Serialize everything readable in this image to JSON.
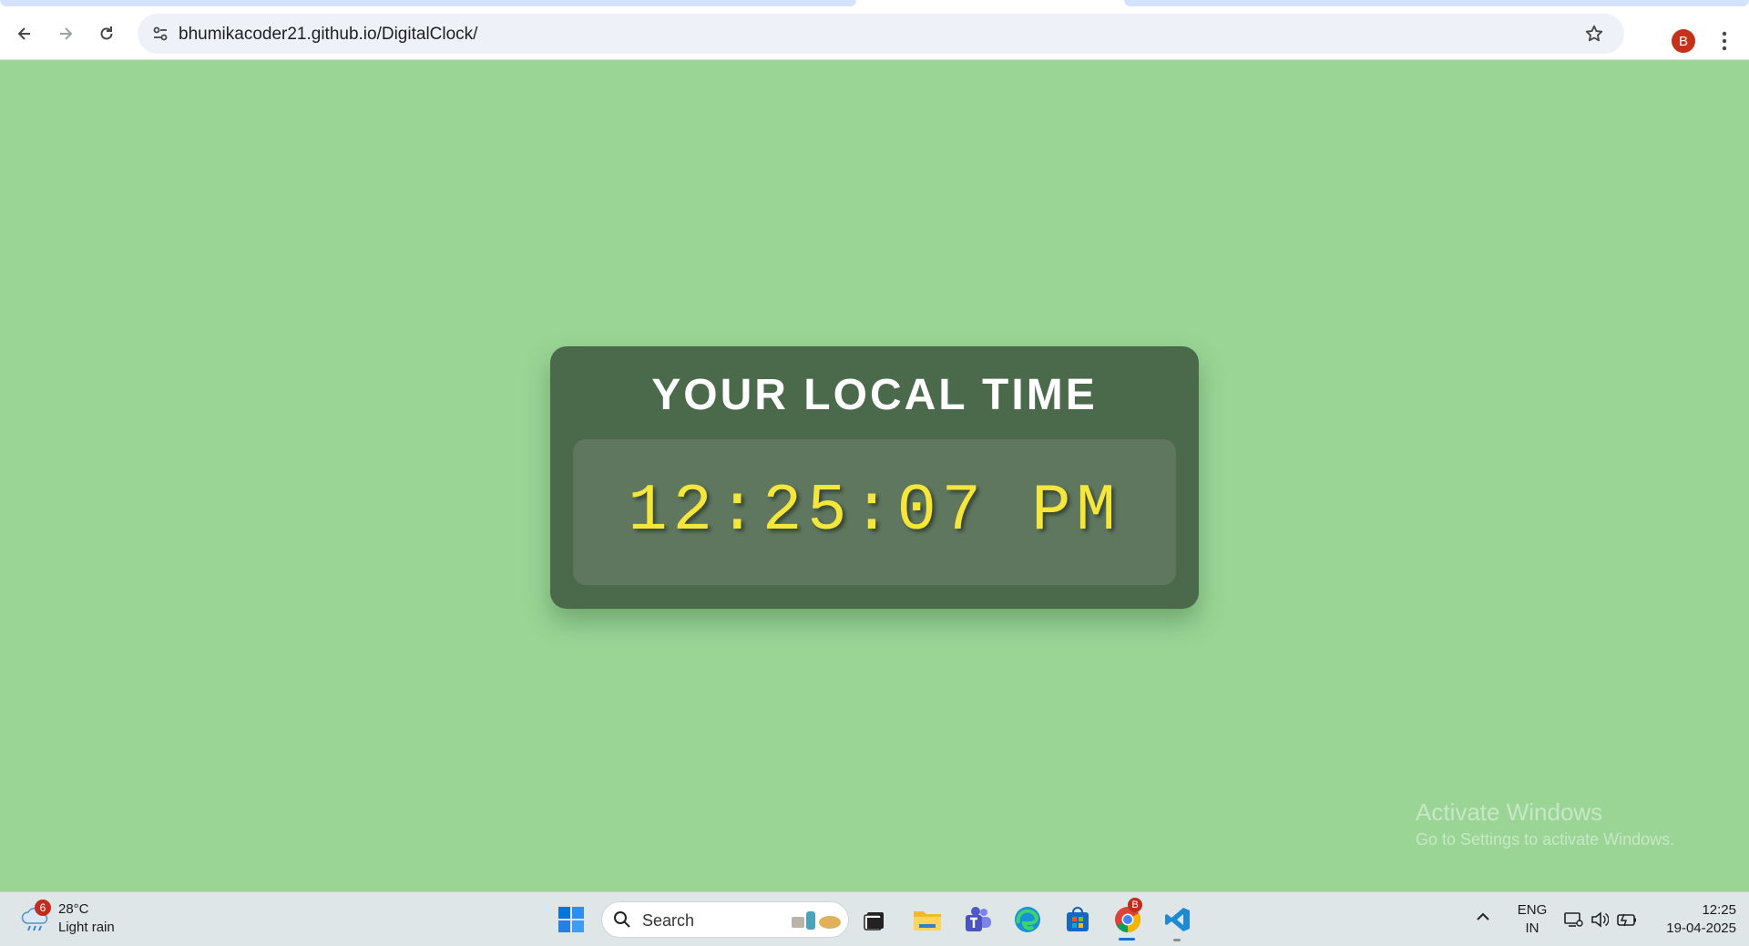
{
  "browser": {
    "url": "bhumikacoder21.github.io/DigitalClock/",
    "profile_initial": "B"
  },
  "page": {
    "title": "YOUR LOCAL TIME",
    "time": "12:25:07 PM"
  },
  "watermark": {
    "title": "Activate Windows",
    "subtitle": "Go to Settings to activate Windows."
  },
  "taskbar": {
    "weather": {
      "badge": "6",
      "temp": "28°C",
      "desc": "Light rain"
    },
    "search_label": "Search",
    "chrome_badge": "B",
    "language": [
      "ENG",
      "IN"
    ],
    "clock": {
      "time": "12:25",
      "date": "19-04-2025"
    }
  },
  "colors": {
    "page_bg": "#9ad596",
    "card_bg": "#4b6a4b",
    "time_panel_bg": "#5f775f",
    "time_color": "#f5e63b"
  }
}
